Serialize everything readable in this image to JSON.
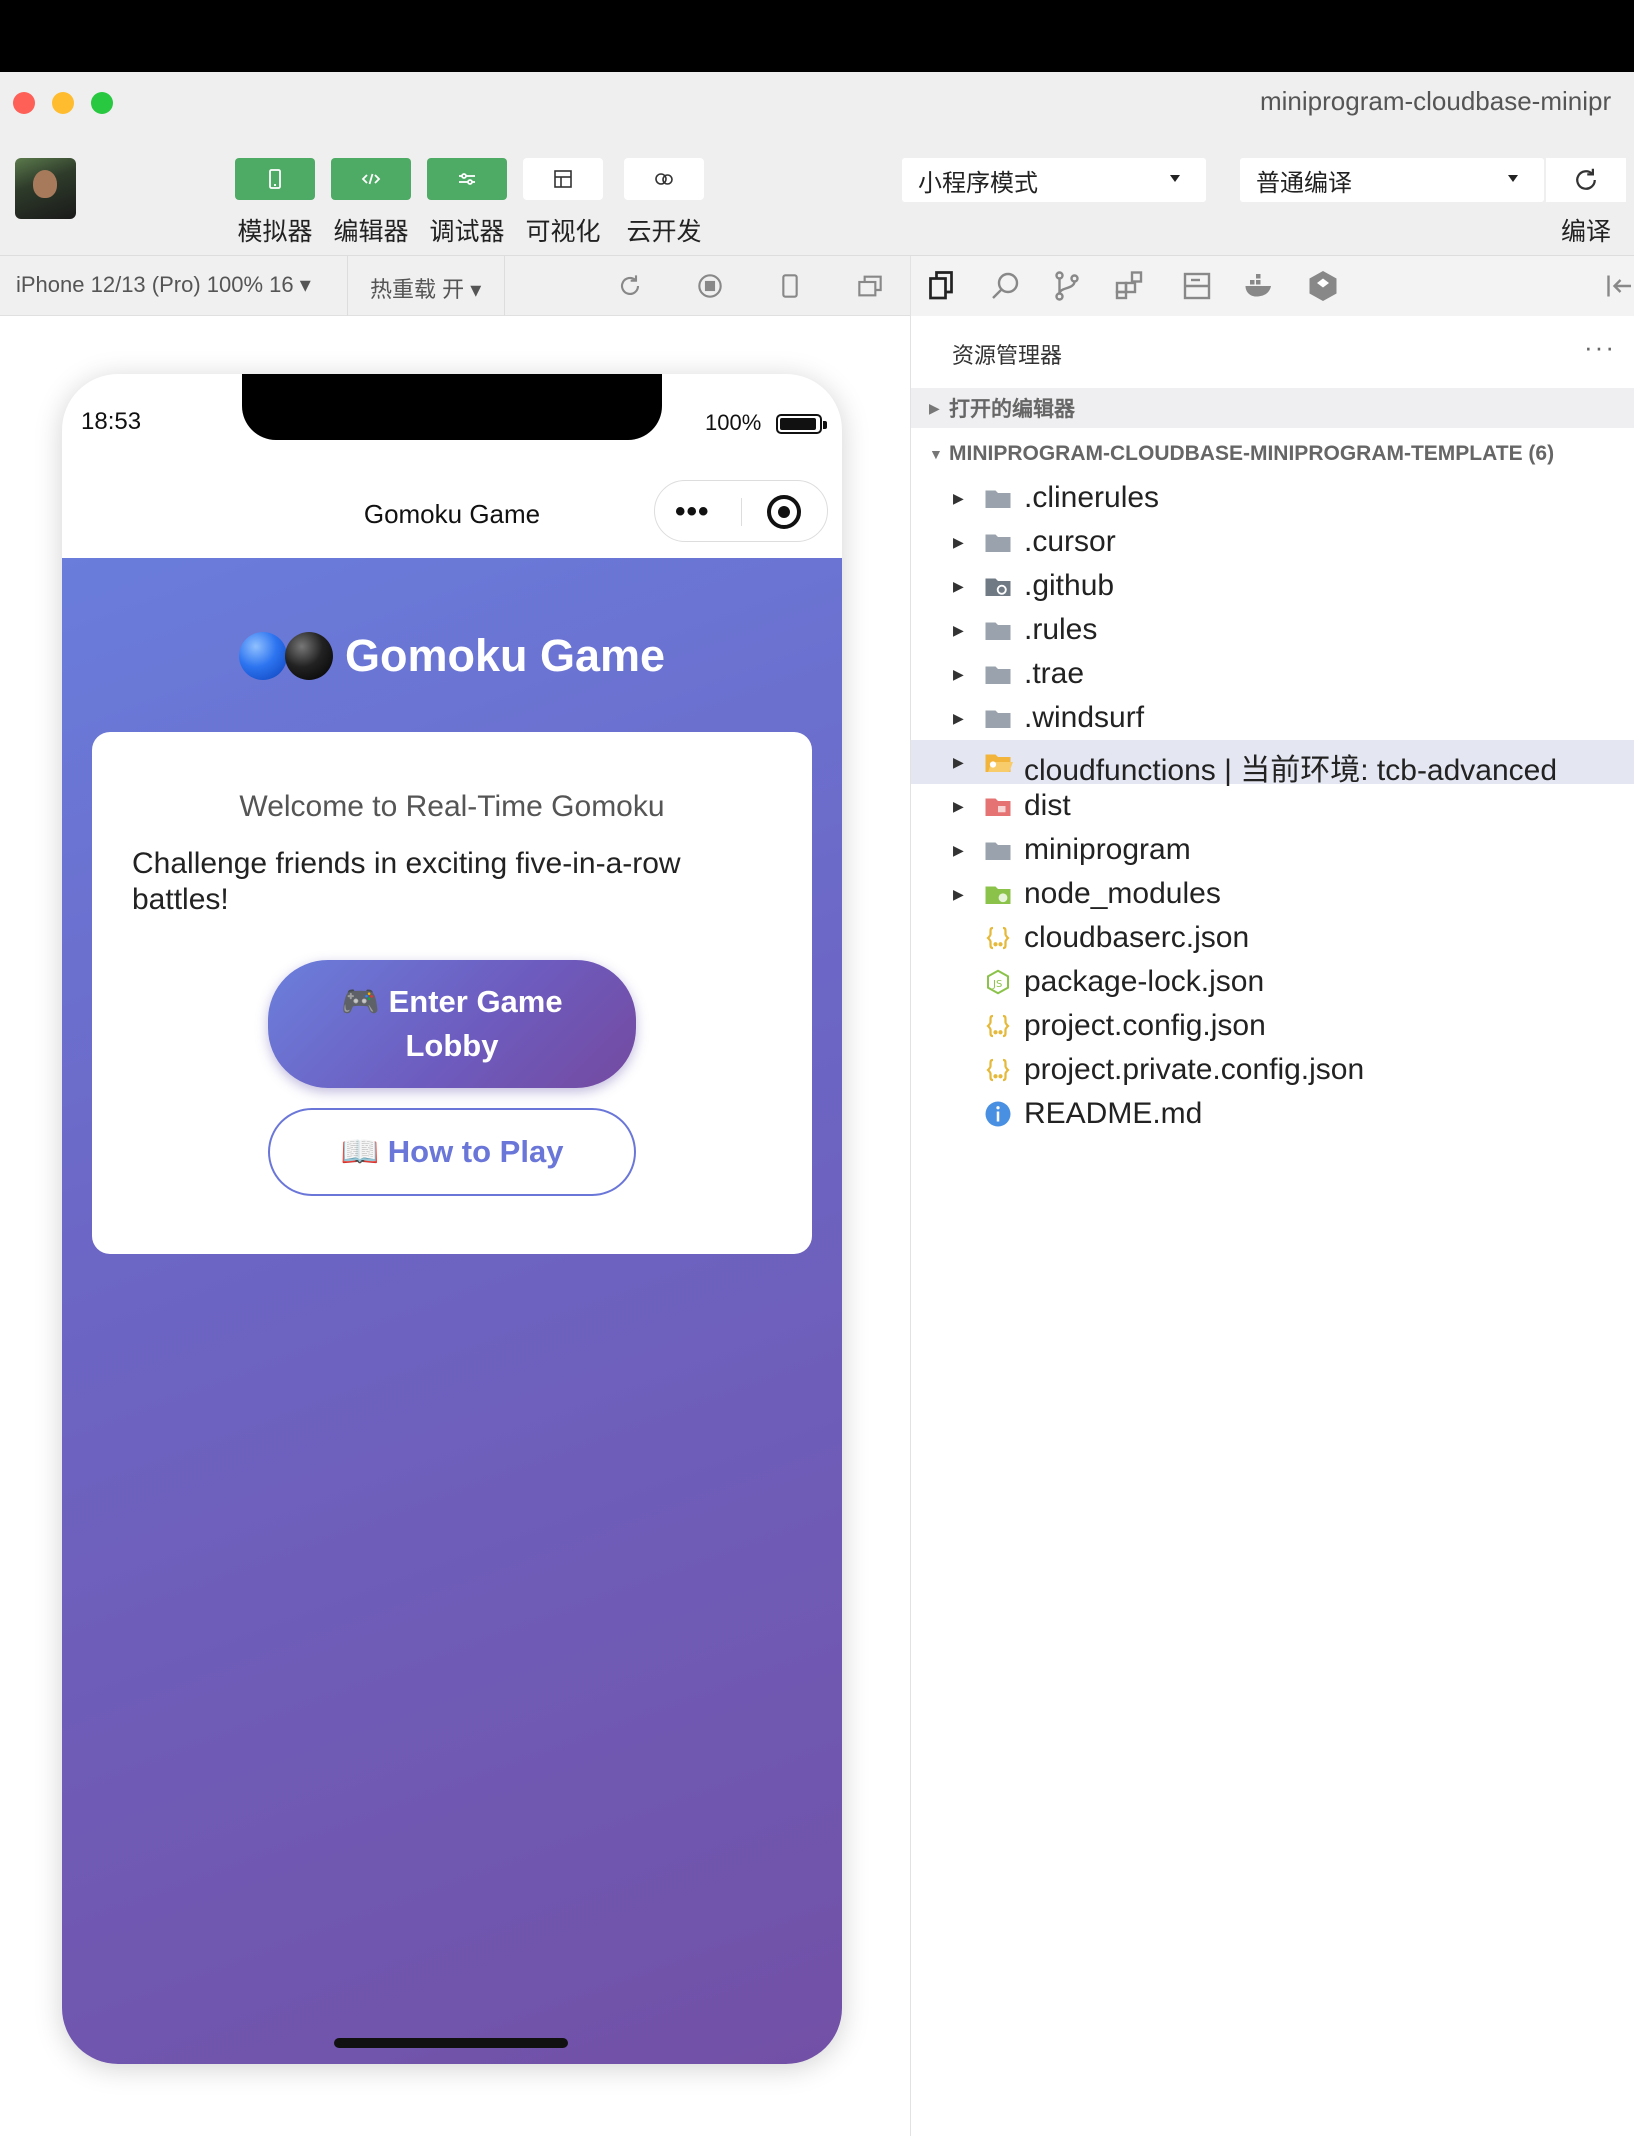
{
  "window": {
    "title": "miniprogram-cloudbase-minipr"
  },
  "toolbar": {
    "buttons": [
      {
        "label": "模拟器",
        "icon": "phone-icon",
        "style": "green"
      },
      {
        "label": "编辑器",
        "icon": "code-icon",
        "style": "green"
      },
      {
        "label": "调试器",
        "icon": "debug-icon",
        "style": "green"
      },
      {
        "label": "可视化",
        "icon": "layout-icon",
        "style": "white"
      },
      {
        "label": "云开发",
        "icon": "cloud-icon",
        "style": "white"
      }
    ],
    "mode_select": "小程序模式",
    "compile_select": "普通编译",
    "compile_label": "编译"
  },
  "simulator_bar": {
    "device": "iPhone 12/13 (Pro) 100% 16 ▾",
    "hot_reload": "热重载 开 ▾"
  },
  "phone": {
    "status_time": "18:53",
    "battery_text": "100%",
    "nav_title": "Gomoku Game",
    "capsule_dots": "•••",
    "game_title": "Gomoku Game",
    "welcome": "Welcome to Real-Time Gomoku",
    "tagline": "Challenge friends in exciting five-in-a-row battles!",
    "enter_line1": "🎮 Enter Game",
    "enter_line2": "Lobby",
    "howto": "📖 How to Play"
  },
  "explorer": {
    "title": "资源管理器",
    "more": "···",
    "open_editors": "打开的编辑器",
    "project": "MINIPROGRAM-CLOUDBASE-MINIPROGRAM-TEMPLATE (6)",
    "items": [
      {
        "name": ".clinerules",
        "type": "folder",
        "icon": "folder-icon"
      },
      {
        "name": ".cursor",
        "type": "folder",
        "icon": "folder-icon"
      },
      {
        "name": ".github",
        "type": "folder",
        "icon": "github-folder-icon"
      },
      {
        "name": ".rules",
        "type": "folder",
        "icon": "folder-icon"
      },
      {
        "name": ".trae",
        "type": "folder",
        "icon": "folder-icon"
      },
      {
        "name": ".windsurf",
        "type": "folder",
        "icon": "folder-icon"
      },
      {
        "name": "cloudfunctions | 当前环境: tcb-advanced",
        "type": "folder",
        "icon": "cloud-folder-icon",
        "selected": true
      },
      {
        "name": "dist",
        "type": "folder",
        "icon": "dist-folder-icon"
      },
      {
        "name": "miniprogram",
        "type": "folder",
        "icon": "folder-icon"
      },
      {
        "name": "node_modules",
        "type": "folder",
        "icon": "node-folder-icon"
      },
      {
        "name": "cloudbaserc.json",
        "type": "file",
        "icon": "json-icon"
      },
      {
        "name": "package-lock.json",
        "type": "file",
        "icon": "nodejs-icon"
      },
      {
        "name": "project.config.json",
        "type": "file",
        "icon": "json-icon"
      },
      {
        "name": "project.private.config.json",
        "type": "file",
        "icon": "json-icon"
      },
      {
        "name": "README.md",
        "type": "file",
        "icon": "info-icon"
      }
    ]
  },
  "colors": {
    "accent_green": "#4eab65",
    "gradient_start": "#6a7ddb",
    "gradient_end": "#7250a6",
    "selection": "#e4e6f1"
  }
}
